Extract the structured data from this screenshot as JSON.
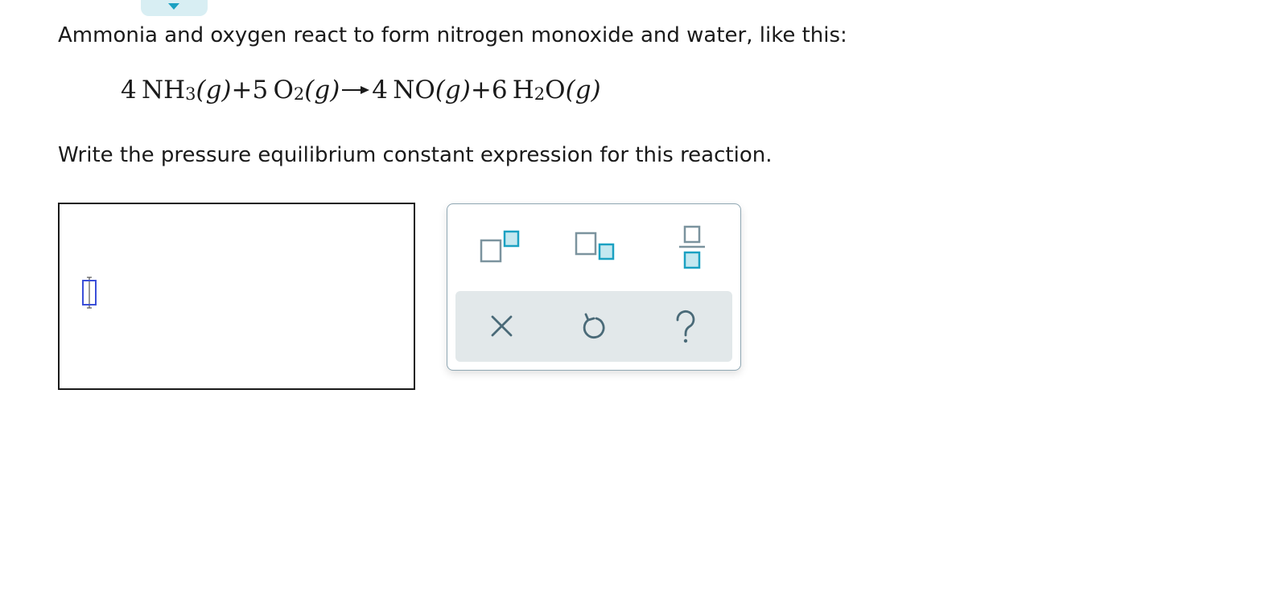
{
  "question": {
    "intro": "Ammonia and oxygen react to form nitrogen monoxide and water, like this:",
    "prompt": "Write the pressure equilibrium constant expression for this reaction."
  },
  "equation": {
    "reactant1": {
      "coef": "4",
      "formula": "NH",
      "sub": "3",
      "state": "(g)"
    },
    "plus1": "+",
    "reactant2": {
      "coef": "5",
      "formula": "O",
      "sub": "2",
      "state": "(g)"
    },
    "product1": {
      "coef": "4",
      "formula": "NO",
      "state": "(g)"
    },
    "plus2": "+",
    "product2": {
      "coef": "6",
      "formula_a": "H",
      "sub": "2",
      "formula_b": "O",
      "state": "(g)"
    }
  },
  "palette": {
    "buttons": [
      "superscript-icon",
      "subscript-icon",
      "fraction-icon"
    ],
    "actions": [
      "clear-icon",
      "undo-icon",
      "help-icon"
    ]
  },
  "colors": {
    "accent": "#1ba1c2",
    "icon_gray": "#7b939e",
    "action_bg": "#e2e8ea",
    "cursor_blue": "#3b4fd8"
  }
}
